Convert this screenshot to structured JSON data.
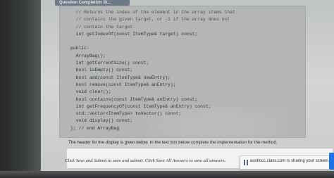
{
  "header": {
    "title": "Question Completion St..."
  },
  "code_lines": [
    {
      "text": "  // Returns the index of the element in the array items that",
      "kind": "comment"
    },
    {
      "text": "  // contains the given target, or -1 if the array does not",
      "kind": "comment"
    },
    {
      "text": "  // contain the target.",
      "kind": "comment"
    },
    {
      "text": "  int getIndexOf(const ItemType& target) const;",
      "kind": "code"
    },
    {
      "text": "",
      "kind": "code"
    },
    {
      "text": "public:",
      "kind": "code"
    },
    {
      "text": "  ArrayBag();",
      "kind": "code"
    },
    {
      "text": "  int getCurrentSize() const;",
      "kind": "code"
    },
    {
      "text": "  bool isEmpty() const;",
      "kind": "code"
    },
    {
      "text": "  bool add(const ItemType& newEntry);",
      "kind": "code"
    },
    {
      "text": "  bool remove(const ItemType& anEntry);",
      "kind": "code"
    },
    {
      "text": "  void clear();",
      "kind": "code"
    },
    {
      "text": "  bool contains(const ItemType& anEntry) const;",
      "kind": "code"
    },
    {
      "text": "  int getFrequencyOf(const ItemType& anEntry) const;",
      "kind": "code"
    },
    {
      "text": "  std::vector<ItemType> toVector() const;",
      "kind": "code"
    },
    {
      "text": "  void display() const;",
      "kind": "code"
    },
    {
      "text": "}; // end ArrayBag",
      "kind": "code"
    }
  ],
  "instruction": "The header for the display is given below. In the text box below complete the implementation for the method.",
  "footer": {
    "text": "Click Save and Submit to save and submit. Click Save All Answers to save all answers."
  },
  "share_bar": {
    "text": "austincc.class.com is sharing your screen."
  },
  "colors": {
    "stop_share_accent": "#1a73e8"
  }
}
